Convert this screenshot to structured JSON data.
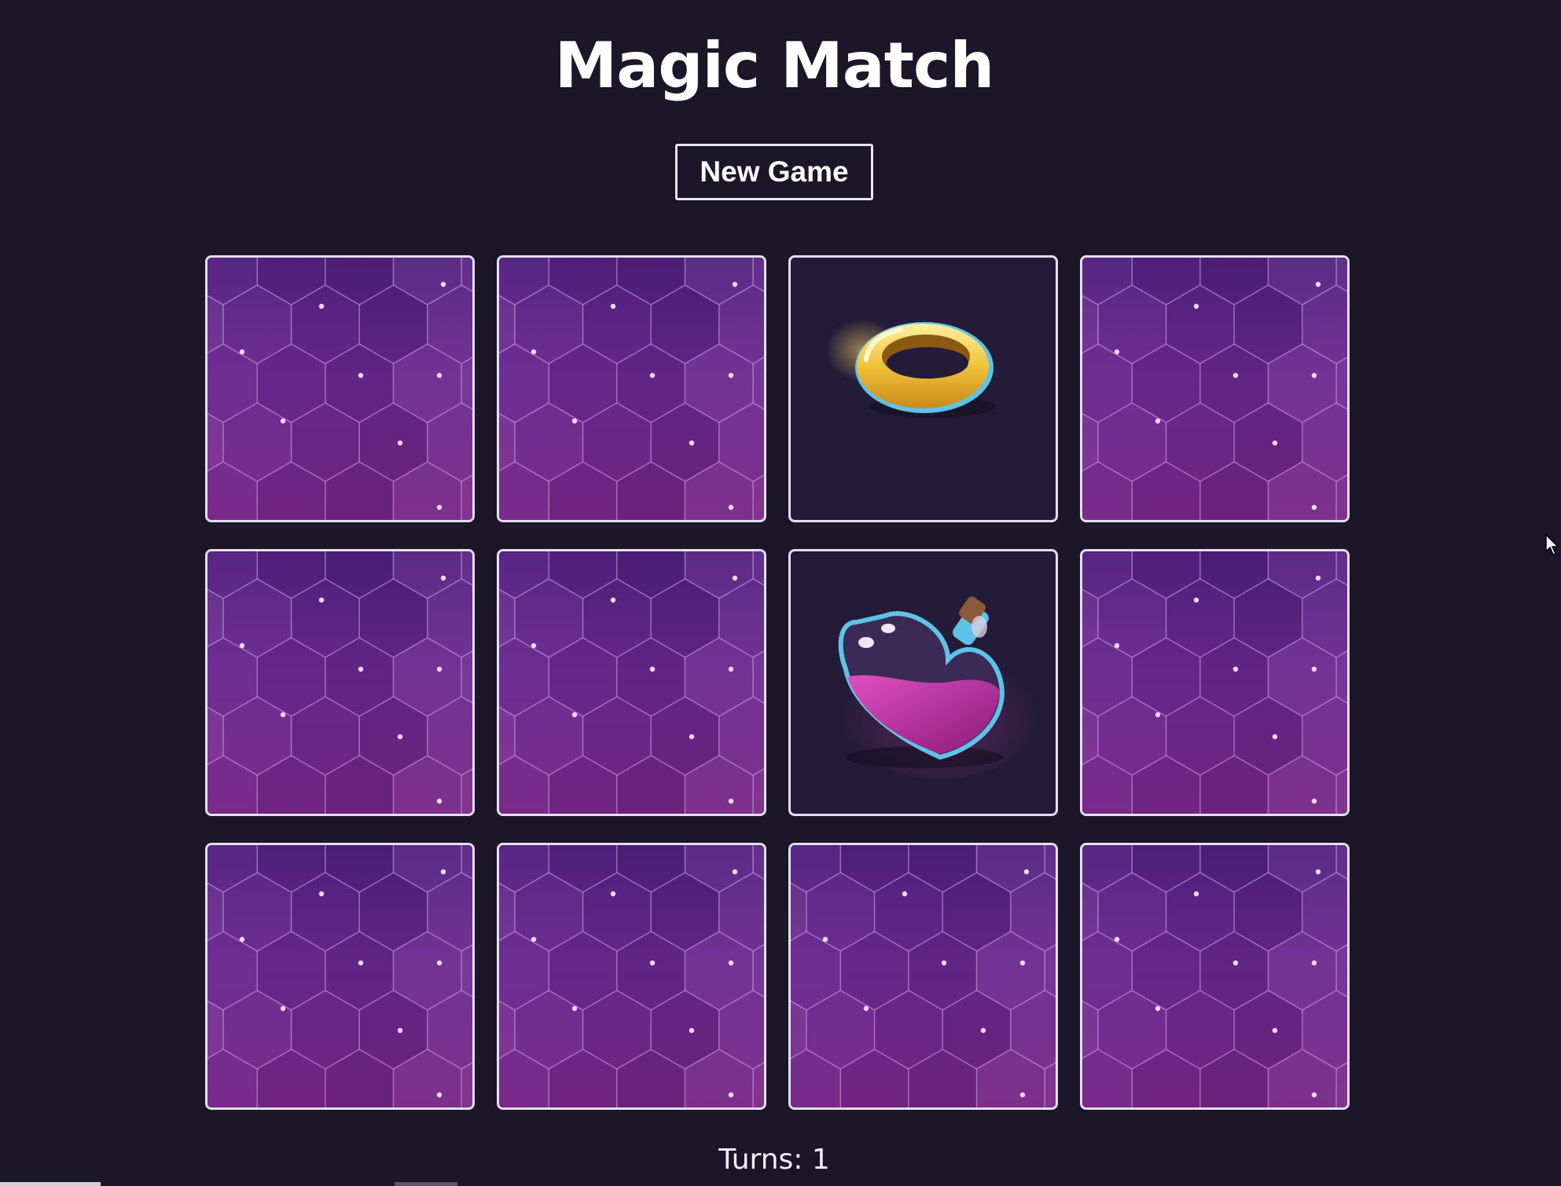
{
  "header": {
    "title": "Magic Match",
    "new_game_label": "New Game"
  },
  "cards": [
    {
      "state": "face-down",
      "icon": "hex-pattern-card-back"
    },
    {
      "state": "face-down",
      "icon": "hex-pattern-card-back"
    },
    {
      "state": "face-up",
      "icon": "gold-ring-icon"
    },
    {
      "state": "face-down",
      "icon": "hex-pattern-card-back"
    },
    {
      "state": "face-down",
      "icon": "hex-pattern-card-back"
    },
    {
      "state": "face-down",
      "icon": "hex-pattern-card-back"
    },
    {
      "state": "face-up",
      "icon": "heart-potion-icon"
    },
    {
      "state": "face-down",
      "icon": "hex-pattern-card-back"
    },
    {
      "state": "face-down",
      "icon": "hex-pattern-card-back"
    },
    {
      "state": "face-down",
      "icon": "hex-pattern-card-back"
    },
    {
      "state": "face-down",
      "icon": "hex-pattern-card-back"
    },
    {
      "state": "face-down",
      "icon": "hex-pattern-card-back"
    }
  ],
  "footer": {
    "turns_label": "Turns:",
    "turns_value": "1"
  },
  "colors": {
    "background": "#1b1628",
    "card_back": "#6a2a8e",
    "card_border": "#e4dff0",
    "face_up_bg": "#231b38"
  }
}
